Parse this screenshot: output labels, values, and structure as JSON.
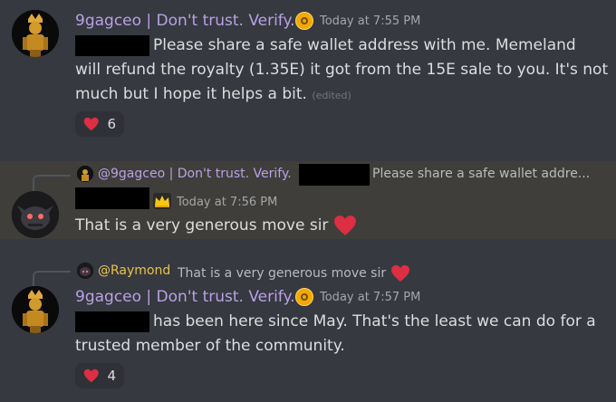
{
  "messages": [
    {
      "author": "9gagceo | Don't trust. Verify.",
      "timestamp": "Today at 7:55 PM",
      "lines": [
        "Please share a safe wallet address with me. Memeland",
        "will refund the royalty (1.35E) it got from the 15E sale to you. It's not",
        "much but I hope it helps a bit."
      ],
      "edited": "(edited)",
      "reaction": {
        "emoji": "heart-icon",
        "count": "6"
      }
    },
    {
      "reply_to": {
        "author": "@9gagceo | Don't trust. Verify.",
        "text": "Please share a safe wallet addre..."
      },
      "timestamp": "Today at 7:56 PM",
      "text": "That is a very generous move sir"
    },
    {
      "reply_to": {
        "author": "@Raymond",
        "text": "That is a very generous move sir"
      },
      "author": "9gagceo | Don't trust. Verify.",
      "timestamp": "Today at 7:57 PM",
      "lines": [
        "has been here since May. That's the least we can do for a",
        "trusted member of the community."
      ],
      "reaction": {
        "emoji": "heart-icon",
        "count": "4"
      }
    }
  ],
  "colors": {
    "background": "#36393f",
    "highlight": "#3f3e3a",
    "author_9gag": "#b9a1e6",
    "author_raymond": "#e6c34a",
    "heart": "#dd2e44"
  }
}
